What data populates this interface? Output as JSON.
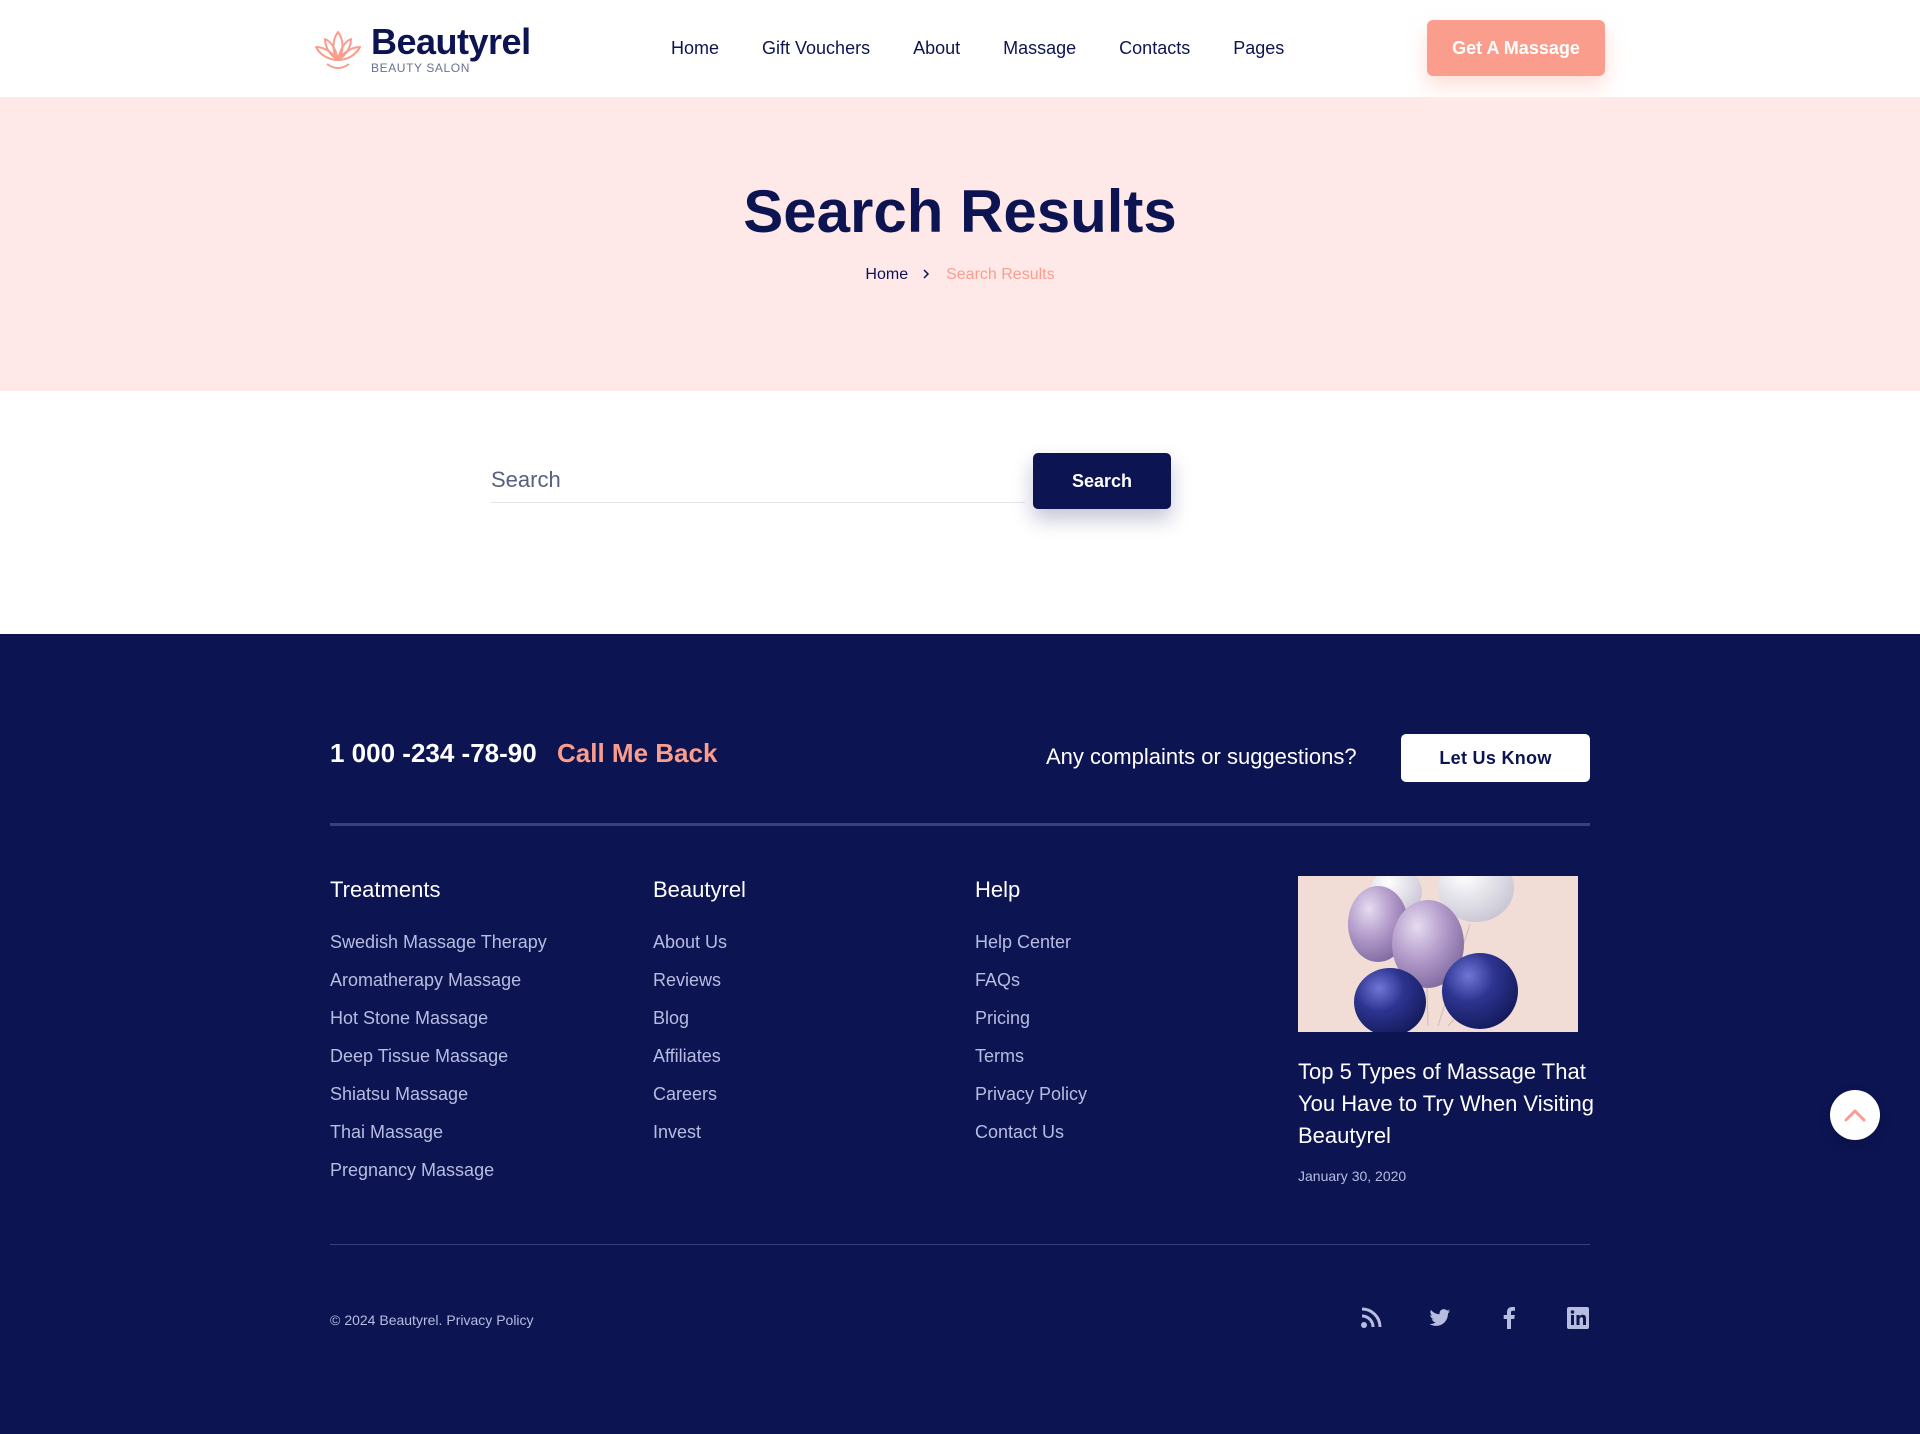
{
  "header": {
    "logo_name": "Beautyrel",
    "logo_tagline": "BEAUTY SALON",
    "nav": [
      "Home",
      "Gift Vouchers",
      "About",
      "Massage",
      "Contacts",
      "Pages"
    ],
    "cta_label": "Get A Massage"
  },
  "hero": {
    "title": "Search Results",
    "breadcrumb_home": "Home",
    "breadcrumb_current": "Search Results"
  },
  "search": {
    "placeholder": "Search",
    "button_label": "Search"
  },
  "footer": {
    "phone": "1 000 -234 -78-90",
    "callback_label": "Call Me Back",
    "complaints_text": "Any complaints or suggestions?",
    "let_us_know_label": "Let Us Know",
    "columns": [
      {
        "title": "Treatments",
        "links": [
          "Swedish Massage Therapy",
          "Aromatherapy Massage",
          "Hot Stone Massage",
          "Deep Tissue Massage",
          "Shiatsu Massage",
          "Thai Massage",
          "Pregnancy Massage"
        ]
      },
      {
        "title": "Beautyrel",
        "links": [
          "About Us",
          "Reviews",
          "Blog",
          "Affiliates",
          "Careers",
          "Invest"
        ]
      },
      {
        "title": "Help",
        "links": [
          "Help Center",
          "FAQs",
          "Pricing",
          "Terms",
          "Privacy Policy",
          "Contact Us"
        ]
      }
    ],
    "post": {
      "title": "Top 5 Types of Massage That You Have to Try When Visiting Beautyrel",
      "date": "January 30, 2020"
    },
    "copyright_symbol": "©",
    "copyright_text": "2024 Beautyrel.",
    "copyright_link": "Privacy Policy",
    "social_icons": [
      "rss-icon",
      "twitter-icon",
      "facebook-icon",
      "linkedin-icon"
    ]
  },
  "colors": {
    "navy": "#0c1452",
    "accent": "#fb9d8c",
    "hero_bg": "#ffe9e8",
    "footer_link": "#b7bde0"
  }
}
